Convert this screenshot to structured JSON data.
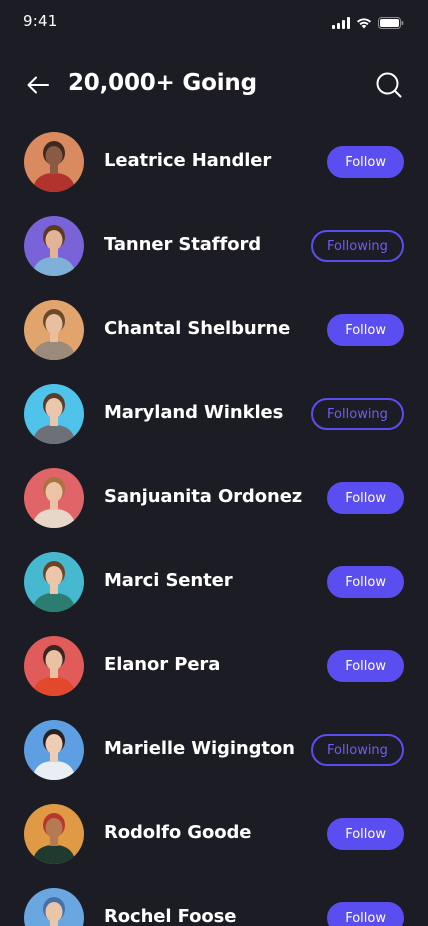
{
  "status_bar": {
    "time": "9:41"
  },
  "header": {
    "title": "20,000+ Going"
  },
  "colors": {
    "background": "#1c1c24",
    "accent": "#5b4ef0",
    "text": "#ffffff"
  },
  "users": [
    {
      "name": "Leatrice Handler",
      "button": "Follow",
      "state": "follow",
      "avatar_bg": "#d98a5e",
      "skin": "#8a5a44",
      "hair": "#3a2a22",
      "shirt": "#b2322e"
    },
    {
      "name": "Tanner Stafford",
      "button": "Following",
      "state": "following",
      "avatar_bg": "#7a62d9",
      "skin": "#e2b497",
      "hair": "#5a3b22",
      "shirt": "#7fb0d8"
    },
    {
      "name": "Chantal Shelburne",
      "button": "Follow",
      "state": "follow",
      "avatar_bg": "#e0a46c",
      "skin": "#e9bf9f",
      "hair": "#6b4a2c",
      "shirt": "#9c8a7a"
    },
    {
      "name": "Maryland Winkles",
      "button": "Following",
      "state": "following",
      "avatar_bg": "#4fc3ea",
      "skin": "#eac6ad",
      "hair": "#5a3c2a",
      "shirt": "#6e7078"
    },
    {
      "name": "Sanjuanita Ordonez",
      "button": "Follow",
      "state": "follow",
      "avatar_bg": "#e06468",
      "skin": "#edc3a6",
      "hair": "#a9733e",
      "shirt": "#e7d7c9"
    },
    {
      "name": "Marci Senter",
      "button": "Follow",
      "state": "follow",
      "avatar_bg": "#46b8cf",
      "skin": "#ecc6aa",
      "hair": "#6b4426",
      "shirt": "#2b7d72"
    },
    {
      "name": "Elanor Pera",
      "button": "Follow",
      "state": "follow",
      "avatar_bg": "#e15b5b",
      "skin": "#eac2a3",
      "hair": "#3a2620",
      "shirt": "#e2482c"
    },
    {
      "name": "Marielle Wigington",
      "button": "Following",
      "state": "following",
      "avatar_bg": "#5e9ee2",
      "skin": "#efcdb5",
      "hair": "#2a2020",
      "shirt": "#e9eef4"
    },
    {
      "name": "Rodolfo Goode",
      "button": "Follow",
      "state": "follow",
      "avatar_bg": "#e09a45",
      "skin": "#b57a52",
      "hair": "#b8372c",
      "shirt": "#1f3b2f"
    },
    {
      "name": "Rochel Foose",
      "button": "Follow",
      "state": "follow",
      "avatar_bg": "#6aa6e0",
      "skin": "#ebc5a8",
      "hair": "#4a6fa8",
      "shirt": "#3c6aa8"
    }
  ]
}
